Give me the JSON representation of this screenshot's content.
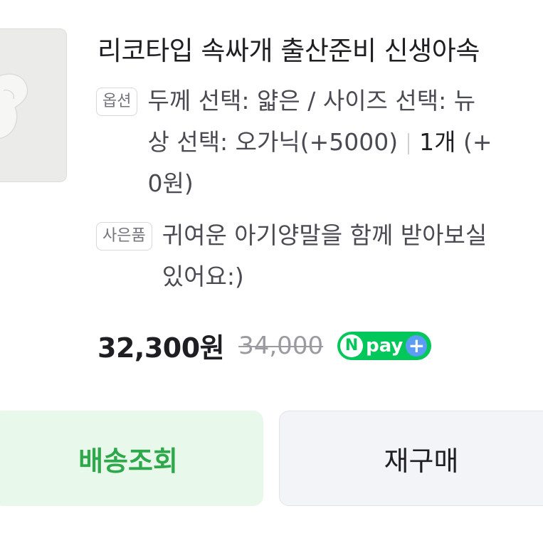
{
  "product": {
    "title": "리코타입 속싸개 출산준비 신생아속",
    "image_icon": "product-thumbnail-image"
  },
  "options": {
    "badge": "옵션",
    "line1": "두께 선택: 얇은 / 사이즈 선택: 뉴",
    "line2_text": "상 선택: 오가닉(+5000)",
    "quantity": "1개",
    "line2_tail": "(+",
    "line3": "0원)"
  },
  "gift": {
    "badge": "사은품",
    "line1": "귀여운 아기양말을 함께 받아보실",
    "line2": "있어요:)"
  },
  "price": {
    "sale": "32,300원",
    "original": "34,000",
    "npay_n": "N",
    "npay_label": "pay",
    "npay_plus": "+"
  },
  "buttons": {
    "track": "배송조회",
    "rebuy": "재구매"
  },
  "colors": {
    "npay_green": "#03c75a",
    "track_green": "#2ea84a",
    "track_bg": "#e8f8ea"
  }
}
